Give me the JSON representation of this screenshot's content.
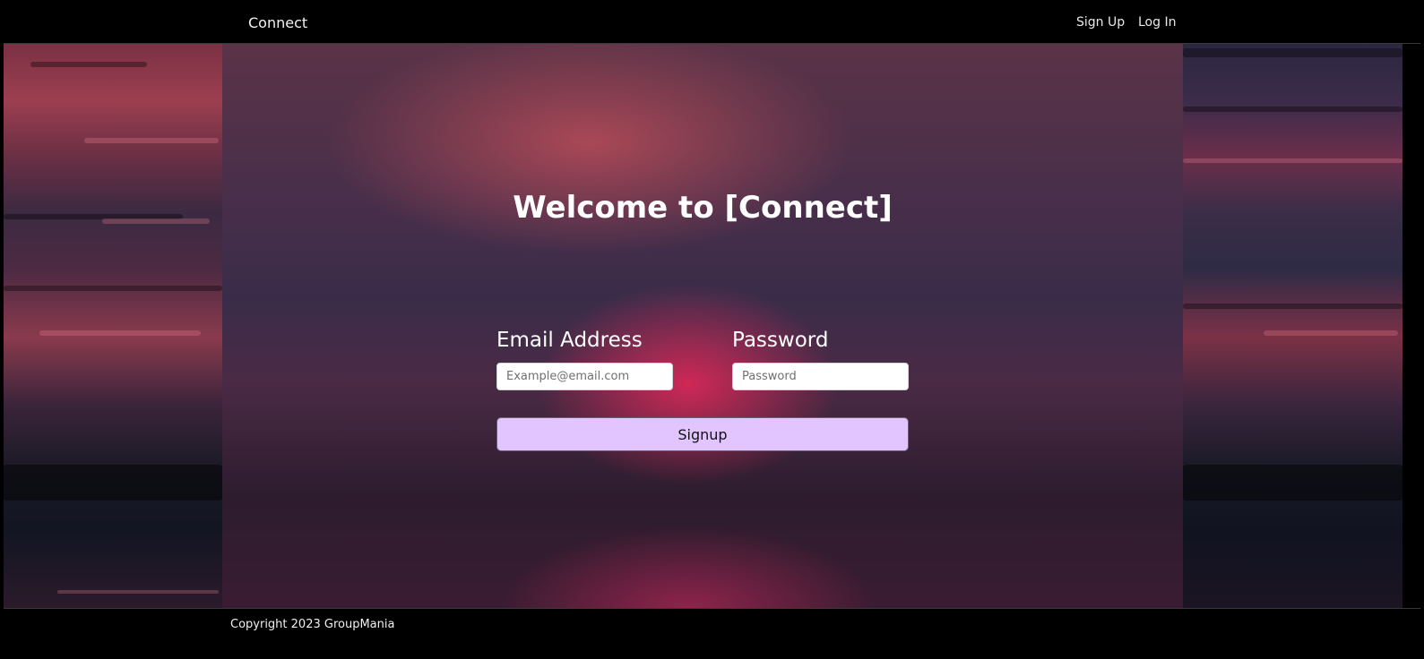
{
  "nav": {
    "brand": "Connect",
    "links": [
      {
        "label": "Sign Up"
      },
      {
        "label": "Log In"
      }
    ]
  },
  "main": {
    "title": "Welcome to [Connect]",
    "email": {
      "label": "Email Address",
      "placeholder": "Example@email.com",
      "value": ""
    },
    "password": {
      "label": "Password",
      "placeholder": "Password",
      "value": ""
    },
    "submit_label": "Signup"
  },
  "footer": {
    "copyright": "Copyright 2023 GroupMania"
  },
  "colors": {
    "button_bg": "#e2c5ff",
    "nav_bg": "#000000"
  }
}
